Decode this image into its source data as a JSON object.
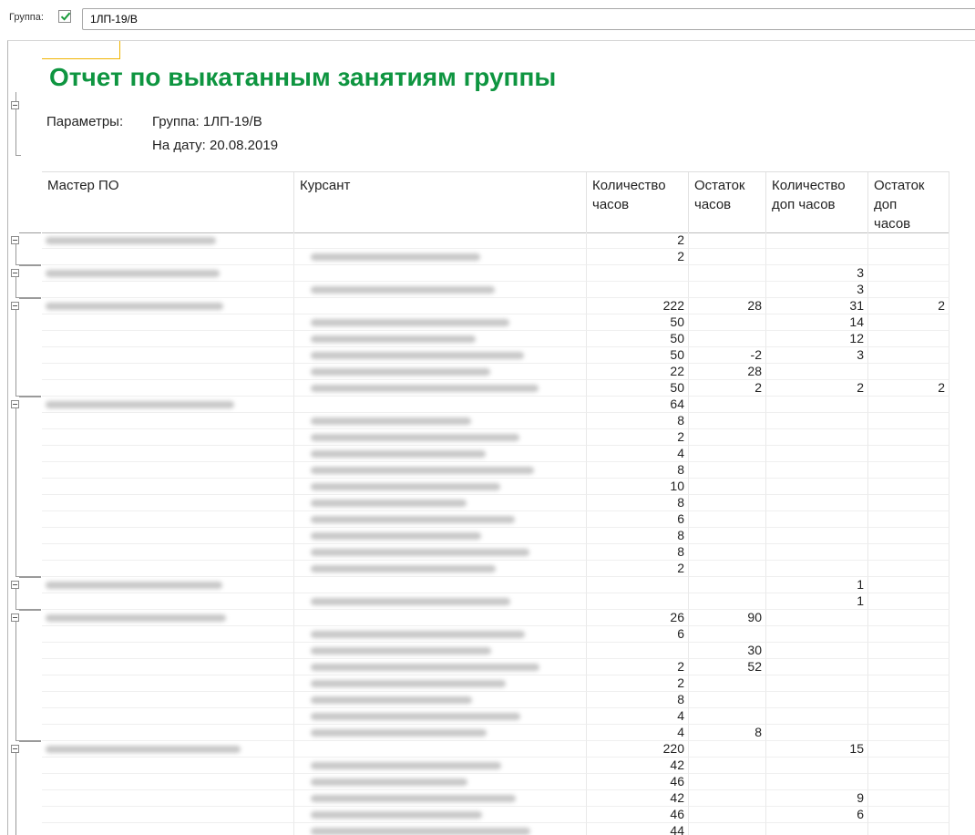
{
  "filter": {
    "group_label": "Группа:",
    "group_value": "1ЛП-19/В"
  },
  "report": {
    "title": "Отчет по выкатанным занятиям группы",
    "params_label": "Параметры:",
    "params_group": "Группа: 1ЛП-19/В",
    "params_date": "На дату: 20.08.2019"
  },
  "headers": {
    "master": "Мастер ПО",
    "cadet": "Курсант",
    "hours": "Количество часов",
    "remain": "Остаток часов",
    "extra": "Количество доп часов",
    "extra_remain": "Остаток доп часов"
  },
  "groups": [
    {
      "rows": [
        {
          "type": "master",
          "hours": "2",
          "remain": "",
          "extra": "",
          "extra_remain": ""
        },
        {
          "type": "cadet",
          "hours": "2",
          "remain": "",
          "extra": "",
          "extra_remain": ""
        }
      ]
    },
    {
      "rows": [
        {
          "type": "master",
          "hours": "",
          "remain": "",
          "extra": "3",
          "extra_remain": ""
        },
        {
          "type": "cadet",
          "hours": "",
          "remain": "",
          "extra": "3",
          "extra_remain": ""
        }
      ]
    },
    {
      "rows": [
        {
          "type": "master",
          "hours": "222",
          "remain": "28",
          "extra": "31",
          "extra_remain": "2"
        },
        {
          "type": "cadet",
          "hours": "50",
          "remain": "",
          "extra": "14",
          "extra_remain": ""
        },
        {
          "type": "cadet",
          "hours": "50",
          "remain": "",
          "extra": "12",
          "extra_remain": ""
        },
        {
          "type": "cadet",
          "hours": "50",
          "remain": "-2",
          "extra": "3",
          "extra_remain": ""
        },
        {
          "type": "cadet",
          "hours": "22",
          "remain": "28",
          "extra": "",
          "extra_remain": ""
        },
        {
          "type": "cadet",
          "hours": "50",
          "remain": "2",
          "extra": "2",
          "extra_remain": "2"
        }
      ]
    },
    {
      "rows": [
        {
          "type": "master",
          "hours": "64",
          "remain": "",
          "extra": "",
          "extra_remain": ""
        },
        {
          "type": "cadet",
          "hours": "8",
          "remain": "",
          "extra": "",
          "extra_remain": ""
        },
        {
          "type": "cadet",
          "hours": "2",
          "remain": "",
          "extra": "",
          "extra_remain": ""
        },
        {
          "type": "cadet",
          "hours": "4",
          "remain": "",
          "extra": "",
          "extra_remain": ""
        },
        {
          "type": "cadet",
          "hours": "8",
          "remain": "",
          "extra": "",
          "extra_remain": ""
        },
        {
          "type": "cadet",
          "hours": "10",
          "remain": "",
          "extra": "",
          "extra_remain": ""
        },
        {
          "type": "cadet",
          "hours": "8",
          "remain": "",
          "extra": "",
          "extra_remain": ""
        },
        {
          "type": "cadet",
          "hours": "6",
          "remain": "",
          "extra": "",
          "extra_remain": ""
        },
        {
          "type": "cadet",
          "hours": "8",
          "remain": "",
          "extra": "",
          "extra_remain": ""
        },
        {
          "type": "cadet",
          "hours": "8",
          "remain": "",
          "extra": "",
          "extra_remain": ""
        },
        {
          "type": "cadet",
          "hours": "2",
          "remain": "",
          "extra": "",
          "extra_remain": ""
        }
      ]
    },
    {
      "rows": [
        {
          "type": "master",
          "hours": "",
          "remain": "",
          "extra": "1",
          "extra_remain": ""
        },
        {
          "type": "cadet",
          "hours": "",
          "remain": "",
          "extra": "1",
          "extra_remain": ""
        }
      ]
    },
    {
      "rows": [
        {
          "type": "master",
          "hours": "26",
          "remain": "90",
          "extra": "",
          "extra_remain": ""
        },
        {
          "type": "cadet",
          "hours": "6",
          "remain": "",
          "extra": "",
          "extra_remain": ""
        },
        {
          "type": "cadet",
          "hours": "",
          "remain": "30",
          "extra": "",
          "extra_remain": ""
        },
        {
          "type": "cadet",
          "hours": "2",
          "remain": "52",
          "extra": "",
          "extra_remain": ""
        },
        {
          "type": "cadet",
          "hours": "2",
          "remain": "",
          "extra": "",
          "extra_remain": ""
        },
        {
          "type": "cadet",
          "hours": "8",
          "remain": "",
          "extra": "",
          "extra_remain": ""
        },
        {
          "type": "cadet",
          "hours": "4",
          "remain": "",
          "extra": "",
          "extra_remain": ""
        },
        {
          "type": "cadet",
          "hours": "4",
          "remain": "8",
          "extra": "",
          "extra_remain": ""
        }
      ]
    },
    {
      "rows": [
        {
          "type": "master",
          "hours": "220",
          "remain": "",
          "extra": "15",
          "extra_remain": ""
        },
        {
          "type": "cadet",
          "hours": "42",
          "remain": "",
          "extra": "",
          "extra_remain": ""
        },
        {
          "type": "cadet",
          "hours": "46",
          "remain": "",
          "extra": "",
          "extra_remain": ""
        },
        {
          "type": "cadet",
          "hours": "42",
          "remain": "",
          "extra": "9",
          "extra_remain": ""
        },
        {
          "type": "cadet",
          "hours": "46",
          "remain": "",
          "extra": "6",
          "extra_remain": ""
        },
        {
          "type": "cadet",
          "hours": "44",
          "remain": "",
          "extra": "",
          "extra_remain": ""
        }
      ]
    }
  ],
  "colors": {
    "title": "#0e9540",
    "checkbox_check": "#1a9b3c",
    "corner_highlight": "#f0b400"
  },
  "icons": [
    "check-icon",
    "collapse-minus-icon"
  ]
}
